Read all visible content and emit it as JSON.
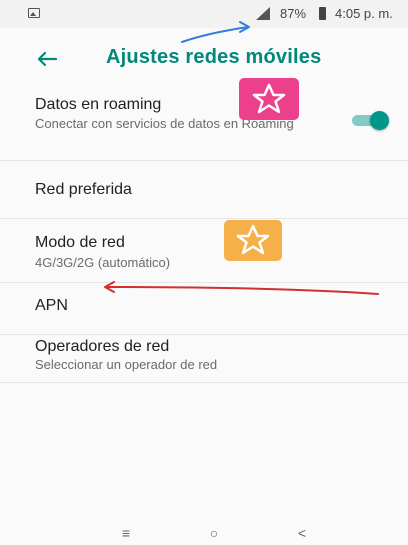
{
  "status_bar": {
    "battery": "87%",
    "time": "4:05 p. m.",
    "icons": [
      "image-notification-icon",
      "signal-icon",
      "battery-icon"
    ]
  },
  "toolbar": {
    "back_icon": "arrow-left-icon",
    "title": "Ajustes redes móviles"
  },
  "items": [
    {
      "title": "Datos en roaming",
      "subtitle": "Conectar con servicios de datos en Roaming",
      "toggle": "on"
    },
    {
      "title": "Red preferida"
    },
    {
      "title": "Modo de red",
      "subtitle": "4G/3G/2G (automático)"
    },
    {
      "title": "APN"
    },
    {
      "title": "Operadores de red",
      "subtitle": "Seleccionar un operador de red"
    }
  ],
  "nav_bar": {
    "recents": "≡",
    "home": "○",
    "back": "<"
  },
  "colors": {
    "accent": "#00897b",
    "toggle_thumb": "#009688",
    "toggle_track": "#80cbc4",
    "sticker_pink": "#ec3f8c",
    "sticker_orange": "#f5b04a",
    "arrow_red": "#d32f2f",
    "arrow_blue": "#2f7fd8"
  }
}
